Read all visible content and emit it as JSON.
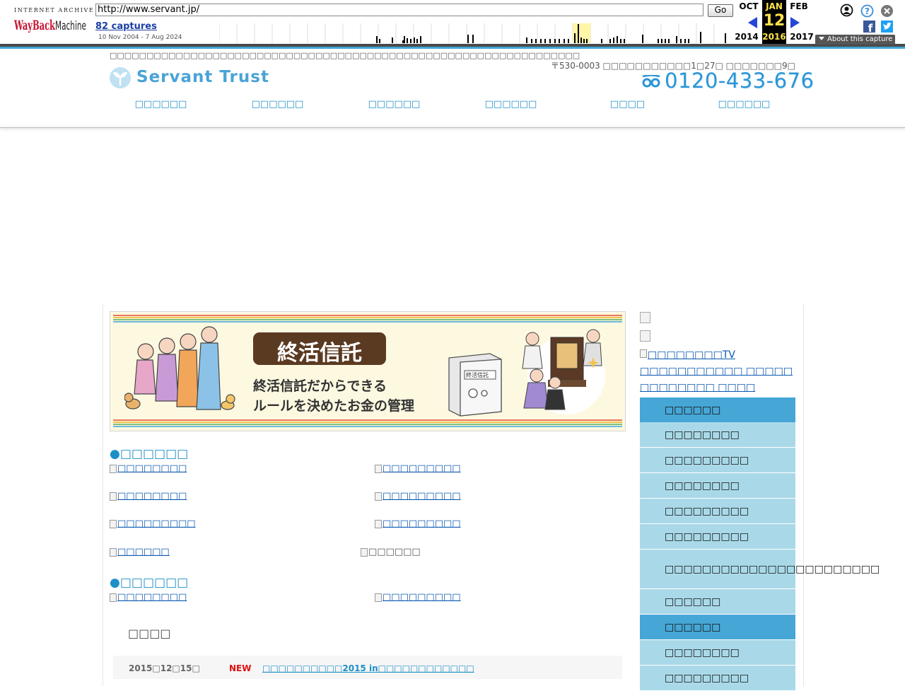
{
  "wayback": {
    "logo_top": "INTERNET ARCHIVE",
    "logo_text": "WayBackMachine",
    "url": "http://www.servant.jp/",
    "go_label": "Go",
    "captures": "82 captures",
    "range": "10 Nov 2004 - 7 Aug 2024",
    "prev_month": "OCT",
    "prev_year": "2014",
    "cur_month": "JAN",
    "cur_day": "12",
    "cur_year": "2016",
    "next_month": "FEB",
    "next_year": "2017",
    "about": "About this capture"
  },
  "header": {
    "tagline": "□□□□□□□□□□□□□□□□□□□□□□□□□□□□□□□□□□□□□□□□□□□□□□□□□□□□□□□□□□□□□□□□",
    "logo_text": "Servant Trust",
    "address": "〒530-0003 □□□□□□□□□□□1□27□ □□□□□□□9□",
    "phone": "0120-433-676"
  },
  "nav": [
    "□□□□□□",
    "□□□□□□",
    "□□□□□□",
    "□□□□□□",
    "□□□□",
    "□□□□□□"
  ],
  "banner": {
    "title": "終活信託",
    "line1": "終活信託だからできる",
    "line2": "ルールを決めたお金の管理",
    "safe_label": "終活信託"
  },
  "section1": {
    "title": "●□□□□□□",
    "links": [
      "□□□□□□□□",
      "□□□□□□□□□",
      "□□□□□□□□",
      "□□□□□□□□□",
      "□□□□□□□□□",
      "□□□□□□□□□",
      "□□□□□□",
      "□□□□□□"
    ]
  },
  "section2": {
    "title": "●□□□□□□",
    "links": [
      "□□□□□□□□",
      "□□□□□□□□□"
    ]
  },
  "news": {
    "title": "□□□□",
    "date": "2015□12□15□",
    "badge": "NEW",
    "text": "□□□□□□□□□□2015 in□□□□□□□□□□□□"
  },
  "sidebar": {
    "tv_text": "□□□□□□□□TV □□□□□□□□□□□ □□□□□ □□□□□□□□ □□□□",
    "menu": [
      {
        "label": "□□□□□□",
        "header": true
      },
      {
        "label": "□□□□□□□□",
        "header": false
      },
      {
        "label": "□□□□□□□□□",
        "header": false
      },
      {
        "label": "□□□□□□□□",
        "header": false
      },
      {
        "label": "□□□□□□□□□",
        "header": false
      },
      {
        "label": "□□□□□□□□□",
        "header": false
      },
      {
        "label": "□□□□□□□□□□□□□□□□□□□□□□□",
        "header": false
      },
      {
        "label": "□□□□□□",
        "header": false
      },
      {
        "label": "□□□□□□",
        "header": true
      },
      {
        "label": "□□□□□□□□",
        "header": false
      },
      {
        "label": "□□□□□□□□□",
        "header": false
      }
    ]
  }
}
